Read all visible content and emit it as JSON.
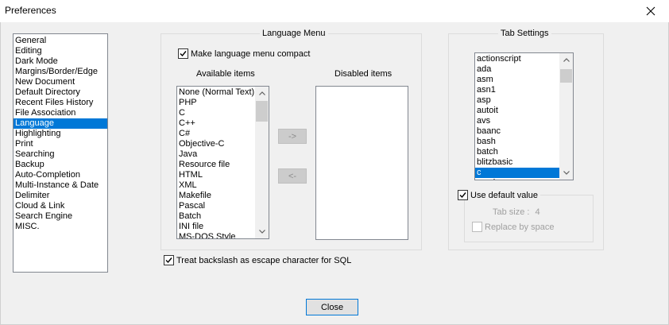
{
  "window": {
    "title": "Preferences",
    "close_icon": "close-icon"
  },
  "categories": [
    "General",
    "Editing",
    "Dark Mode",
    "Margins/Border/Edge",
    "New Document",
    "Default Directory",
    "Recent Files History",
    "File Association",
    "Language",
    "Highlighting",
    "Print",
    "Searching",
    "Backup",
    "Auto-Completion",
    "Multi-Instance & Date",
    "Delimiter",
    "Cloud & Link",
    "Search Engine",
    "MISC."
  ],
  "selected_category": "Language",
  "language_menu": {
    "title": "Language Menu",
    "compact_label": "Make language menu compact",
    "compact_checked": true,
    "available_label": "Available items",
    "disabled_label": "Disabled items",
    "available_items": [
      "None (Normal Text)",
      "PHP",
      "C",
      "C++",
      "C#",
      "Objective-C",
      "Java",
      "Resource file",
      "HTML",
      "XML",
      "Makefile",
      "Pascal",
      "Batch",
      "INI file",
      "MS-DOS Style"
    ],
    "disabled_items": [],
    "move_right_label": "->",
    "move_left_label": "<-"
  },
  "sql": {
    "label": "Treat backslash as escape character for SQL",
    "checked": true
  },
  "tab_settings": {
    "title": "Tab Settings",
    "languages": [
      "actionscript",
      "ada",
      "asm",
      "asn1",
      "asp",
      "autoit",
      "avs",
      "baanc",
      "bash",
      "batch",
      "blitzbasic",
      "c",
      "caml"
    ],
    "selected_language": "c",
    "use_default_label": "Use default value",
    "use_default_checked": true,
    "tab_size_label": "Tab size :",
    "tab_size_value": "4",
    "replace_label": "Replace by space",
    "replace_checked": false
  },
  "close_button_label": "Close",
  "colors": {
    "selection": "#0078d7",
    "dialog_bg": "#f0f0f0",
    "group_border": "#dcdcdc"
  }
}
